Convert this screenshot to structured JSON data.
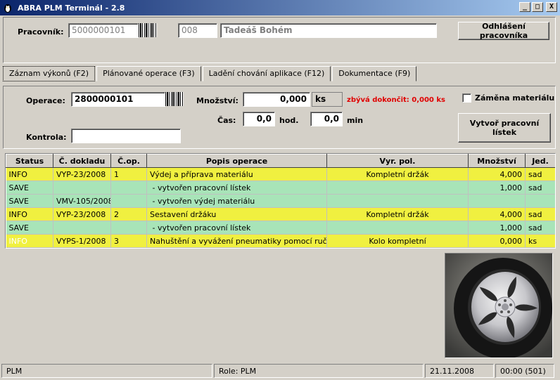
{
  "window": {
    "title": "ABRA PLM Terminál - 2.8",
    "btn_min": "_",
    "btn_max": "□",
    "btn_close": "X"
  },
  "worker": {
    "label": "Pracovník:",
    "id": "5000000101",
    "code": "008",
    "name": "Tadeáš Bohém",
    "logout_label": "Odhlášení pracovníka"
  },
  "tabs": [
    {
      "label": "Záznam výkonů (F2)"
    },
    {
      "label": "Plánované operace (F3)"
    },
    {
      "label": "Ladění chování aplikace (F12)"
    },
    {
      "label": "Dokumentace (F9)"
    }
  ],
  "form": {
    "operation_label": "Operace:",
    "operation_value": "2800000101",
    "check_label": "Kontrola:",
    "check_value": "",
    "quantity_label": "Množství:",
    "quantity_value": "0,000",
    "quantity_unit": "ks",
    "remaining_text": "zbývá dokončit: 0,000 ks",
    "time_label": "Čas:",
    "hours_value": "0,0",
    "hours_unit": "hod.",
    "minutes_value": "0,0",
    "minutes_unit": "min",
    "material_swap_label": "Záměna materiálu",
    "create_ticket_label": "Vytvoř pracovní lístek"
  },
  "table": {
    "headers": [
      "Status",
      "Č. dokladu",
      "Č.op.",
      "Popis operace",
      "Vyr. pol.",
      "Množství",
      "Jed."
    ],
    "rows": [
      {
        "type": "info",
        "status": "INFO",
        "doc": "VYP-23/2008",
        "op": "1",
        "desc": "Výdej a příprava materiálu",
        "item": "Kompletní držák",
        "qty": "4,000",
        "unit": "sad"
      },
      {
        "type": "save",
        "status": "SAVE",
        "doc": "",
        "op": "",
        "desc": " - vytvořen pracovní lístek",
        "item": "",
        "qty": "1,000",
        "unit": "sad"
      },
      {
        "type": "save",
        "status": "SAVE",
        "doc": "VMV-105/2008",
        "op": "",
        "desc": " - vytvořen výdej materiálu",
        "item": "",
        "qty": "",
        "unit": ""
      },
      {
        "type": "info",
        "status": "INFO",
        "doc": "VYP-23/2008",
        "op": "2",
        "desc": "Sestavení držáku",
        "item": "Kompletní držák",
        "qty": "4,000",
        "unit": "sad"
      },
      {
        "type": "save",
        "status": "SAVE",
        "doc": "",
        "op": "",
        "desc": " - vytvořen pracovní lístek",
        "item": "",
        "qty": "1,000",
        "unit": "sad"
      },
      {
        "type": "info dim",
        "status": "INFO",
        "doc": "VYPS-1/2008",
        "op": "3",
        "desc": "Nahuštění a vyvážení pneumatiky pomocí ruční hust",
        "item": "Kolo kompletní",
        "qty": "0,000",
        "unit": "ks"
      }
    ]
  },
  "status": {
    "app": "PLM",
    "role": "Role: PLM",
    "date": "21.11.2008",
    "time": "00:00 (501)"
  }
}
